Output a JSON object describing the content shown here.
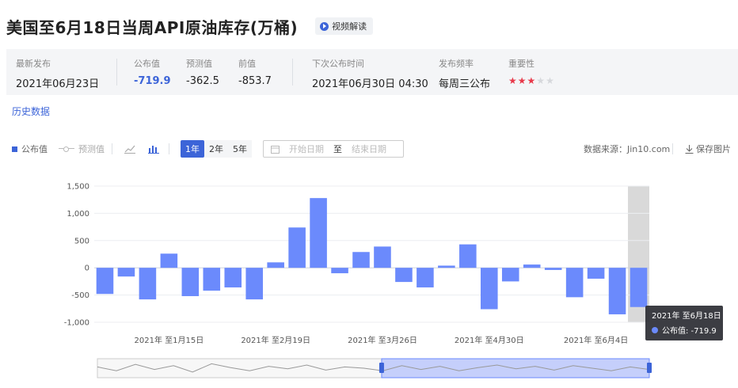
{
  "header": {
    "title": "美国至6月18日当周API原油库存(万桶)",
    "video_label": "视频解读"
  },
  "infobar": {
    "latest_label": "最新发布",
    "latest_value": "2021年06月23日",
    "actual_label": "公布值",
    "actual_value": "-719.9",
    "forecast_label": "预测值",
    "forecast_value": "-362.5",
    "previous_label": "前值",
    "previous_value": "-853.7",
    "next_label": "下次公布时间",
    "next_value": "2021年06月30日 04:30",
    "freq_label": "发布频率",
    "freq_value": "每周三公布",
    "importance_label": "重要性",
    "importance_stars": 3,
    "importance_max": 5
  },
  "history_label": "历史数据",
  "toolbar": {
    "legend_actual": "公布值",
    "legend_forecast": "预测值",
    "periods": [
      "1年",
      "2年",
      "5年"
    ],
    "active_period": "1年",
    "start_placeholder": "开始日期",
    "to_label": "至",
    "end_placeholder": "结束日期",
    "source": "数据来源：Jin10.com",
    "save_image": "保存图片"
  },
  "chart_data": {
    "type": "bar",
    "title": "",
    "xlabel": "",
    "ylabel": "",
    "ylim": [
      -1000,
      1500
    ],
    "yticks": [
      -1000,
      -500,
      0,
      500,
      1000,
      1500
    ],
    "ytick_labels": [
      "-1,000",
      "-500",
      "0",
      "500",
      "1,000",
      "1,500"
    ],
    "xtick_labels": [
      "2021年 至1月15日",
      "2021年 至2月19日",
      "2021年 至3月26日",
      "2021年 至4月30日",
      "2021年 至6月4日"
    ],
    "xtick_indices": [
      3,
      8,
      13,
      18,
      23
    ],
    "grid": true,
    "bar_color": "#6b8afc",
    "series": [
      {
        "name": "公布值",
        "values": [
          -480,
          -160,
          -580,
          260,
          -520,
          -420,
          -360,
          -580,
          100,
          740,
          1280,
          -100,
          290,
          390,
          -260,
          -360,
          40,
          430,
          -760,
          -250,
          60,
          -40,
          -540,
          -200,
          -854,
          -720
        ]
      }
    ],
    "highlight_index": 25,
    "tooltip": {
      "date": "2021年 至6月18日",
      "series_label": "公布值",
      "value": "-719.9"
    }
  }
}
